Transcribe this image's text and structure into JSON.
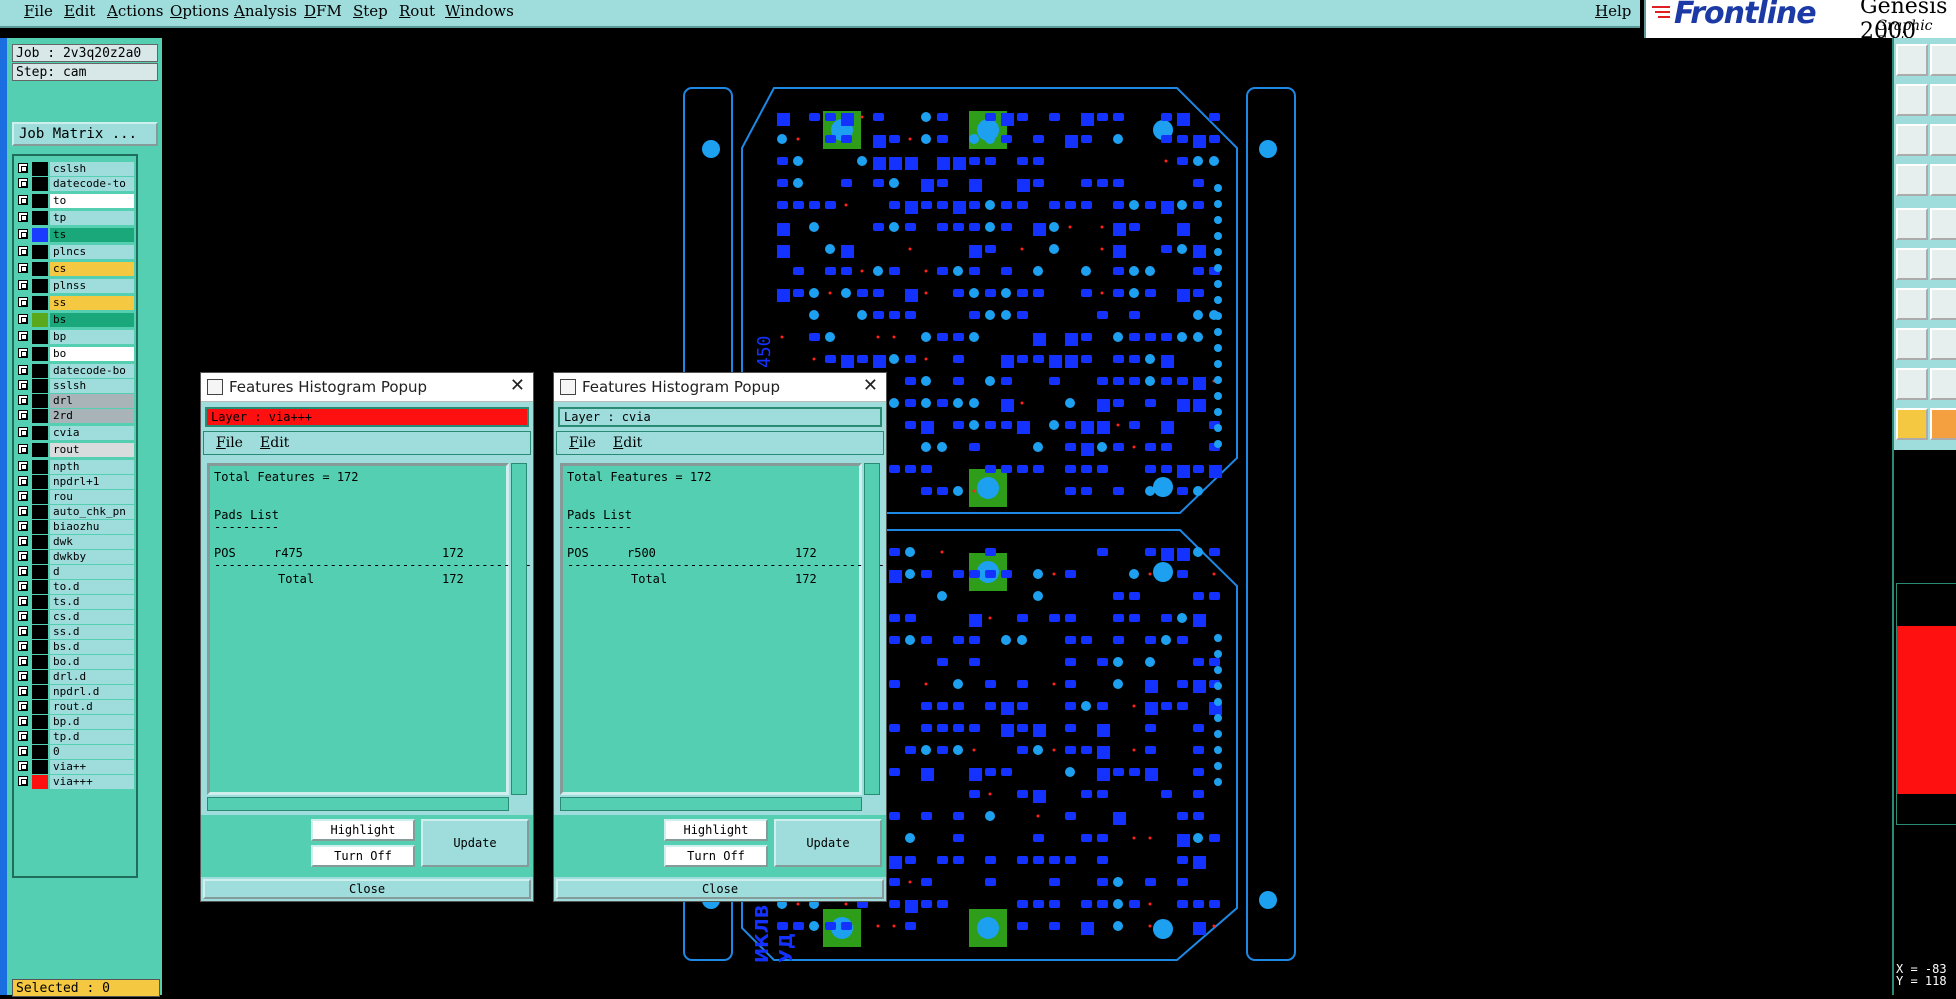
{
  "menu": [
    "File",
    "Edit",
    "Actions",
    "Options",
    "Analysis",
    "DFM",
    "Step",
    "Rout",
    "Windows"
  ],
  "help": "Help",
  "brand": {
    "logo": "Frontline",
    "product": "Genesis 2000",
    "subtitle": "Graphic Editor"
  },
  "job": "Job : 2v3q20z2a0",
  "step": "Step: cam",
  "job_matrix": "Job Matrix ...",
  "layers": [
    {
      "name": "cslsh",
      "color": "#000000",
      "bg": "#9fdcdc"
    },
    {
      "name": "datecode-to",
      "color": "#000000",
      "bg": "#9fdcdc"
    },
    {
      "name": "to",
      "color": "#000000",
      "bg": "#ffffff"
    },
    {
      "name": "tp",
      "color": "#000000",
      "bg": "#9fdcdc"
    },
    {
      "name": "ts",
      "color": "#1a3cff",
      "bg": "#1aa87a"
    },
    {
      "name": "plncs",
      "color": "#000000",
      "bg": "#9fdcdc"
    },
    {
      "name": "cs",
      "color": "#000000",
      "bg": "#f5c842"
    },
    {
      "name": "plnss",
      "color": "#000000",
      "bg": "#9fdcdc"
    },
    {
      "name": "ss",
      "color": "#000000",
      "bg": "#f5c842"
    },
    {
      "name": "bs",
      "color": "#5aa81c",
      "bg": "#1aa87a"
    },
    {
      "name": "bp",
      "color": "#000000",
      "bg": "#9fdcdc"
    },
    {
      "name": "bo",
      "color": "#000000",
      "bg": "#ffffff"
    },
    {
      "name": "datecode-bo",
      "color": "#000000",
      "bg": "#9fdcdc"
    },
    {
      "name": "sslsh",
      "color": "#000000",
      "bg": "#9fdcdc"
    },
    {
      "name": "drl",
      "color": "#000000",
      "bg": "#a8b4b8"
    },
    {
      "name": "2rd",
      "color": "#000000",
      "bg": "#a8b4b8"
    },
    {
      "name": "cvia",
      "color": "#000000",
      "bg": "#9fdcdc"
    },
    {
      "name": "rout",
      "color": "#000000",
      "bg": "#d8dcdc"
    },
    {
      "name": "npth",
      "color": "#000000",
      "bg": "#9fdcdc"
    },
    {
      "name": "npdrl+1",
      "color": "#000000",
      "bg": "#9fdcdc"
    },
    {
      "name": "rou",
      "color": "#000000",
      "bg": "#9fdcdc"
    },
    {
      "name": "auto_chk_pn",
      "color": "#000000",
      "bg": "#9fdcdc"
    },
    {
      "name": "biaozhu",
      "color": "#000000",
      "bg": "#9fdcdc"
    },
    {
      "name": "dwk",
      "color": "#000000",
      "bg": "#9fdcdc"
    },
    {
      "name": "dwkby",
      "color": "#000000",
      "bg": "#9fdcdc"
    },
    {
      "name": "d",
      "color": "#000000",
      "bg": "#9fdcdc"
    },
    {
      "name": "to.d",
      "color": "#000000",
      "bg": "#9fdcdc"
    },
    {
      "name": "ts.d",
      "color": "#000000",
      "bg": "#9fdcdc"
    },
    {
      "name": "cs.d",
      "color": "#000000",
      "bg": "#9fdcdc"
    },
    {
      "name": "ss.d",
      "color": "#000000",
      "bg": "#9fdcdc"
    },
    {
      "name": "bs.d",
      "color": "#000000",
      "bg": "#9fdcdc"
    },
    {
      "name": "bo.d",
      "color": "#000000",
      "bg": "#9fdcdc"
    },
    {
      "name": "drl.d",
      "color": "#000000",
      "bg": "#9fdcdc"
    },
    {
      "name": "npdrl.d",
      "color": "#000000",
      "bg": "#9fdcdc"
    },
    {
      "name": "rout.d",
      "color": "#000000",
      "bg": "#9fdcdc"
    },
    {
      "name": "bp.d",
      "color": "#000000",
      "bg": "#9fdcdc"
    },
    {
      "name": "tp.d",
      "color": "#000000",
      "bg": "#9fdcdc"
    },
    {
      "name": "0",
      "color": "#000000",
      "bg": "#9fdcdc"
    },
    {
      "name": "via++",
      "color": "#000000",
      "bg": "#9fdcdc"
    },
    {
      "name": "via+++",
      "color": "#ff1010",
      "bg": "#9fdcdc"
    }
  ],
  "selected": "Selected : 0",
  "coords": {
    "x": "X = -83",
    "y": "Y = 118"
  },
  "popups": [
    {
      "title": "Features Histogram Popup",
      "layer": "Layer :  via+++",
      "layer_bg": "#ff1010",
      "menu": [
        "File",
        "Edit"
      ],
      "total": "Total Features = 172",
      "pads_list": "Pads List",
      "underline": "---------",
      "row": {
        "type": "POS",
        "symbol": "r475",
        "count": "172"
      },
      "rule": "----------------------------------------------",
      "total_label": "Total",
      "total_count": "172",
      "buttons": {
        "highlight": "Highlight",
        "turn_off": "Turn Off",
        "update": "Update",
        "close": "Close"
      }
    },
    {
      "title": "Features Histogram Popup",
      "layer": "Layer :  cvia",
      "layer_bg": "#9fdcdc",
      "menu": [
        "File",
        "Edit"
      ],
      "total": "Total Features = 172",
      "pads_list": "Pads List",
      "underline": "---------",
      "row": {
        "type": "POS",
        "symbol": "r500",
        "count": "172"
      },
      "rule": "----------------------------------------------",
      "total_label": "Total",
      "total_count": "172",
      "buttons": {
        "highlight": "Highlight",
        "turn_off": "Turn Off",
        "update": "Update",
        "close": "Close"
      }
    }
  ],
  "board_text": [
    "450",
    "ИКЛВ",
    "УД"
  ],
  "colors": {
    "panel": "#55cfb1",
    "menubar": "#9fdcdc",
    "pad_blue": "#1432ff",
    "via_cyan": "#1ea0f0",
    "green_pad": "#2e9e1a",
    "outline": "#1e88e5"
  }
}
